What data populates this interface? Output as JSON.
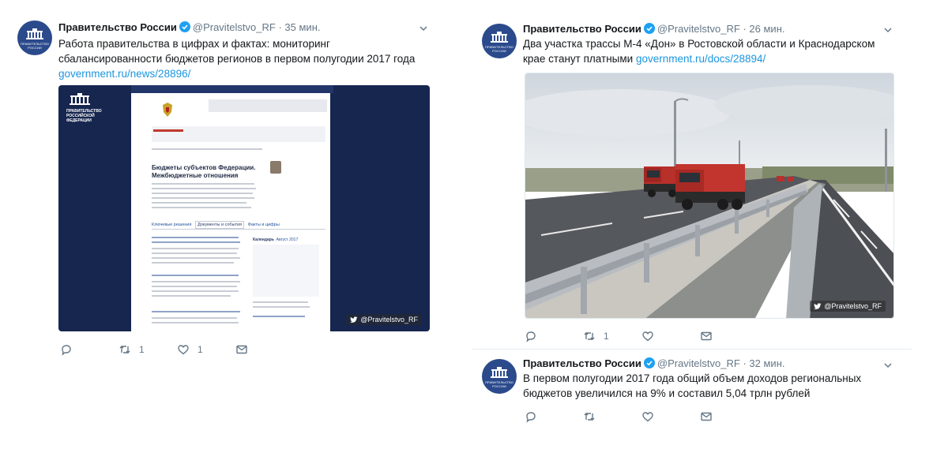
{
  "tweets": [
    {
      "author": "Правительство России",
      "handle": "@Pravitelstvo_RF",
      "separator": "·",
      "time": "35 мин.",
      "text_lines": [
        "Работа правительства в цифрах и фактах: мониторинг",
        "сбалансированности бюджетов регионов в первом полугодии 2017 года"
      ],
      "link": "government.ru/news/28896/",
      "retweets": "1",
      "likes": "1",
      "media": {
        "type": "website-screenshot",
        "logo_text": [
          "ПРАВИТЕЛЬСТВО",
          "РОССИЙСКОЙ",
          "ФЕДЕРАЦИИ"
        ],
        "page_heading": [
          "Бюджеты субъектов Федерации.",
          "Межбюджетные отношения"
        ],
        "tabs": [
          "Ключевые решения",
          "Документы и события",
          "Факты и цифры"
        ],
        "calendar_label": "Календарь",
        "calendar_month": "Август",
        "calendar_year": "2017",
        "watermark": "@Pravitelstvo_RF"
      }
    },
    {
      "author": "Правительство России",
      "handle": "@Pravitelstvo_RF",
      "separator": "·",
      "time": "26 мин.",
      "text_lines": [
        "Два участка трассы М-4 «Дон» в Ростовской области и Краснодарском",
        "крае станут платными "
      ],
      "link": "government.ru/docs/28894/",
      "retweets": "1",
      "media": {
        "type": "photo",
        "subject": "highway-with-trucks",
        "watermark": "@Pravitelstvo_RF"
      }
    },
    {
      "author": "Правительство России",
      "handle": "@Pravitelstvo_RF",
      "separator": "·",
      "time": "32 мин.",
      "text_lines": [
        "В первом полугодии 2017 года общий объем доходов региональных",
        "бюджетов увеличился на 9% и составил 5,04 трлн рублей"
      ]
    }
  ],
  "avatar_caption": [
    "ПРАВИТЕЛЬСТВО",
    "РОССИИ"
  ],
  "colors": {
    "link": "#1b95e0",
    "verified": "#1da1f2",
    "muted": "#657786",
    "avatar": "#2b4a8c"
  },
  "icons": [
    "reply-icon",
    "retweet-icon",
    "like-icon",
    "direct-message-icon",
    "verified-icon",
    "chevron-down-icon",
    "twitter-bird-icon"
  ]
}
